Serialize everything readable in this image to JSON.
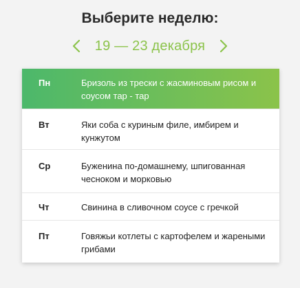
{
  "header": {
    "title": "Выберите неделю:",
    "week_range": "19 — 23 декабря",
    "prev_icon": "chevron-left-icon",
    "next_icon": "chevron-right-icon",
    "accent_color": "#8bc34a"
  },
  "menu": {
    "active_gradient": [
      "#4cb86b",
      "#8bc34a"
    ],
    "rows": [
      {
        "day": "Пн",
        "dish": "Бризоль из трески с жасминовым рисом и соусом тар - тар",
        "active": true
      },
      {
        "day": "Вт",
        "dish": "Яки соба с куриным филе, имбирем и кунжутом",
        "active": false
      },
      {
        "day": "Ср",
        "dish": "Буженина по-домашнему, шпигованная чесноком и морковью",
        "active": false
      },
      {
        "day": "Чт",
        "dish": "Свинина в сливочном соусе с гречкой",
        "active": false
      },
      {
        "day": "Пт",
        "dish": "Говяжьи котлеты с картофелем и жареными грибами",
        "active": false
      }
    ]
  }
}
